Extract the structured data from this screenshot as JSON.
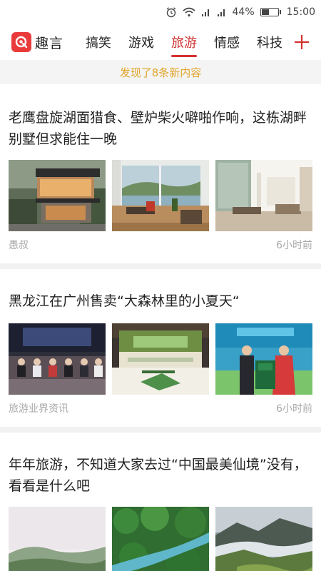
{
  "status_bar": {
    "battery_percent": "44%",
    "time": "15:00"
  },
  "app": {
    "logo_text": "趣言"
  },
  "tabs": [
    {
      "label": "搞笑",
      "active": false
    },
    {
      "label": "游戏",
      "active": false
    },
    {
      "label": "旅游",
      "active": true
    },
    {
      "label": "情感",
      "active": false
    },
    {
      "label": "科技",
      "active": false
    }
  ],
  "banner": {
    "text": "发现了8条新内容"
  },
  "articles": [
    {
      "title": "老鹰盘旋湖面猎食、壁炉柴火噼啪作响，这栋湖畔别墅但求能住一晚",
      "source": "愚叔",
      "time": "6小时前",
      "images": [
        "modern-villa-exterior",
        "lake-view-living-room",
        "minimal-interior-room"
      ]
    },
    {
      "title": "黑龙江在广州售卖“大森林里的小夏天“",
      "source": "旅游业界资讯",
      "time": "6小时前",
      "images": [
        "conference-audience",
        "event-stage-green",
        "ceremony-handshake"
      ]
    },
    {
      "title": "年年旅游，不知道大家去过“中国最美仙境”没有，看看是什么吧",
      "images": [
        "misty-hills",
        "aerial-river-forest",
        "cloudy-mountain-valley"
      ]
    }
  ],
  "colors": {
    "accent": "#d33131",
    "banner_text": "#e0a52a",
    "meta_text": "#a8a8a8"
  }
}
